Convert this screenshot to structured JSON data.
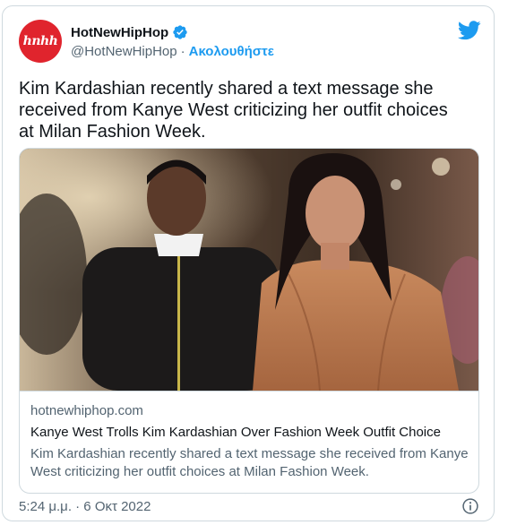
{
  "account": {
    "display_name": "HotNewHipHop",
    "handle": "@HotNewHipHop",
    "separator": "·",
    "follow_label": "Ακολουθήστε",
    "avatar_text": "hnhh",
    "verified": true
  },
  "tweet": {
    "text": "Kim Kardashian recently shared a text message she received from Kanye West criticizing her outfit choices at Milan Fashion Week.",
    "timestamp": "5:24 μ.μ. · 6 Οκτ 2022"
  },
  "card": {
    "domain": "hotnewhiphop.com",
    "title": "Kanye West Trolls Kim Kardashian Over Fashion Week Outfit Choice",
    "description": "Kim Kardashian recently shared a text message she received from Kanye West criticizing her outfit choices at Milan Fashion Week."
  },
  "colors": {
    "brand_blue": "#1d9bf0",
    "avatar_red": "#e0242d",
    "secondary_text": "#536471",
    "border": "#cfd9de"
  },
  "icons": {
    "verified": "verified-badge-icon",
    "bird": "twitter-bird-icon",
    "info": "info-icon"
  }
}
